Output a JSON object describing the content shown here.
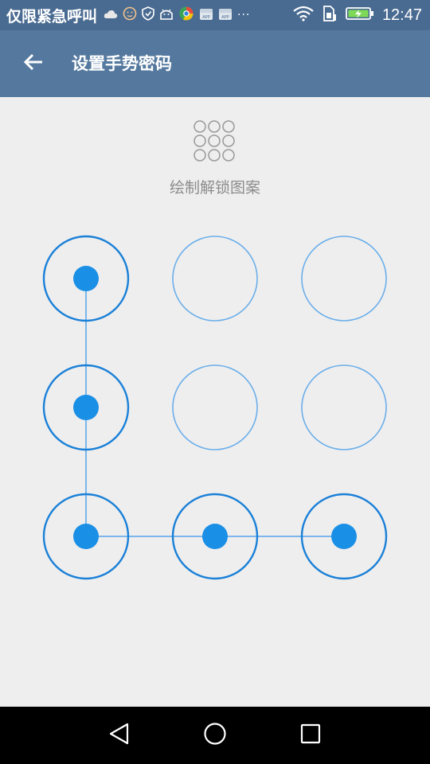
{
  "status_bar": {
    "app_text": "仅限紧急呼叫",
    "more": "···",
    "time": "12:47"
  },
  "app_bar": {
    "title": "设置手势密码"
  },
  "hint_text": "绘制解锁图案",
  "pattern": {
    "selected": [
      true,
      false,
      false,
      true,
      false,
      false,
      true,
      true,
      true
    ],
    "path": [
      0,
      3,
      6,
      7,
      8
    ],
    "active_color": "#1a8fe6",
    "ring_active_color": "#1a80d8",
    "ring_idle_color": "#6aaeea",
    "line_color": "#7bb6ec"
  },
  "colors": {
    "status_bar": "#4a6b91",
    "app_bar": "#55799e",
    "background": "#eeeeee"
  }
}
